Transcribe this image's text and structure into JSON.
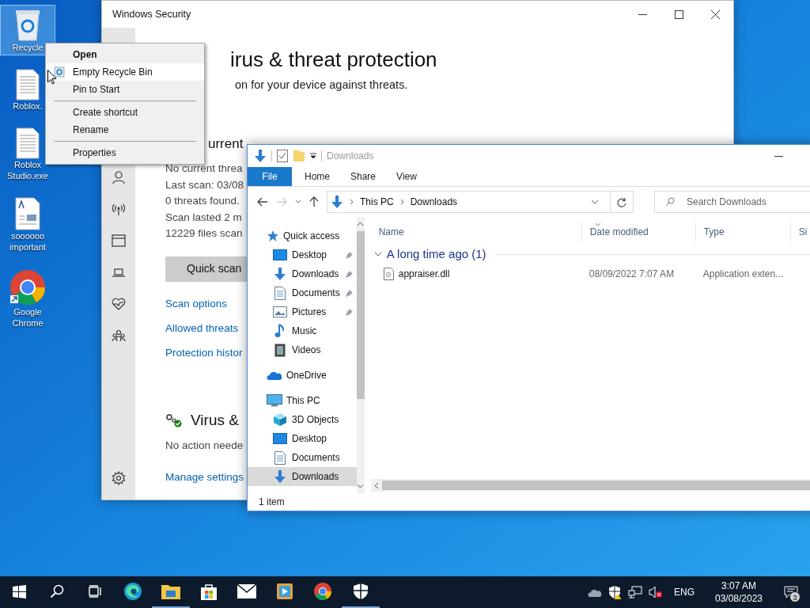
{
  "desktop": {
    "icons": [
      {
        "label": "Recycle",
        "kind": "recycle",
        "selected": true
      },
      {
        "label": "Roblox.",
        "kind": "file",
        "selected": false
      },
      {
        "label": "Roblox Studio.exe",
        "kind": "file",
        "selected": false
      },
      {
        "label": "soooooo important",
        "kind": "document",
        "selected": false
      },
      {
        "label": "Google Chrome",
        "kind": "chrome",
        "selected": false
      }
    ]
  },
  "context_menu": {
    "items": [
      {
        "kind": "item",
        "label": "Open",
        "default": true,
        "selected": false
      },
      {
        "kind": "icon_item",
        "label": "Empty Recycle Bin",
        "default": false,
        "selected": true
      },
      {
        "kind": "item",
        "label": "Pin to Start",
        "default": false,
        "selected": false
      },
      {
        "kind": "separator"
      },
      {
        "kind": "item",
        "label": "Create shortcut",
        "default": false,
        "selected": false
      },
      {
        "kind": "item",
        "label": "Rename",
        "default": false,
        "selected": false
      },
      {
        "kind": "separator"
      },
      {
        "kind": "item",
        "label": "Properties",
        "default": false,
        "selected": false
      }
    ]
  },
  "security": {
    "title": "Windows Security",
    "heading": "irus & threat protection",
    "subtitle": "on for your device against threats.",
    "current_heading": "urrent",
    "status_lines": [
      "No current threa",
      "Last scan: 03/08",
      "0 threats found.",
      "Scan lasted 2 m",
      "12229 files scan"
    ],
    "scan_button": "Quick scan",
    "links": [
      "Scan options",
      "Allowed threats",
      "Protection histor"
    ],
    "settings_heading": "Virus &",
    "settings_status": "No action neede",
    "settings_link": "Manage settings"
  },
  "explorer": {
    "title": "Downloads",
    "ribbon_tabs": [
      {
        "label": "File",
        "selected": true
      },
      {
        "label": "Home",
        "selected": false
      },
      {
        "label": "Share",
        "selected": false
      },
      {
        "label": "View",
        "selected": false
      }
    ],
    "breadcrumb": [
      "This PC",
      "Downloads"
    ],
    "search_placeholder": "Search Downloads",
    "nav": [
      {
        "label": "Quick access",
        "kind": "star",
        "selected": false,
        "children": [
          {
            "label": "Desktop",
            "kind": "desktop",
            "pinned": true,
            "selected": false
          },
          {
            "label": "Downloads",
            "kind": "download",
            "pinned": true,
            "selected": false
          },
          {
            "label": "Documents",
            "kind": "document",
            "pinned": true,
            "selected": false
          },
          {
            "label": "Pictures",
            "kind": "pictures",
            "pinned": true,
            "selected": false
          },
          {
            "label": "Music",
            "kind": "music",
            "pinned": false,
            "selected": false
          },
          {
            "label": "Videos",
            "kind": "videos",
            "pinned": false,
            "selected": false
          }
        ]
      },
      {
        "label": "OneDrive",
        "kind": "cloud",
        "selected": false
      },
      {
        "label": "This PC",
        "kind": "pc",
        "selected": false,
        "children": [
          {
            "label": "3D Objects",
            "kind": "cube",
            "pinned": false,
            "selected": false
          },
          {
            "label": "Desktop",
            "kind": "desktop",
            "pinned": false,
            "selected": false
          },
          {
            "label": "Documents",
            "kind": "document",
            "pinned": false,
            "selected": false
          },
          {
            "label": "Downloads",
            "kind": "download",
            "pinned": false,
            "selected": true
          }
        ]
      }
    ],
    "columns": [
      {
        "label": "Name",
        "sorted": false
      },
      {
        "label": "Date modified",
        "sorted": true
      },
      {
        "label": "Type",
        "sorted": false
      },
      {
        "label": "Si",
        "sorted": false
      }
    ],
    "groups": [
      {
        "label": "A long time ago (1)",
        "expanded": true,
        "files": [
          {
            "name": "appraiser.dll",
            "date": "08/09/2022 7:07 AM",
            "type": "Application exten..."
          }
        ]
      }
    ],
    "status": "1 item"
  },
  "taskbar": {
    "apps": [
      {
        "kind": "start",
        "running": false
      },
      {
        "kind": "search",
        "running": false
      },
      {
        "kind": "taskview",
        "running": false
      },
      {
        "kind": "edge",
        "running": false
      },
      {
        "kind": "explorer",
        "running": true
      },
      {
        "kind": "store",
        "running": false
      },
      {
        "kind": "mail",
        "running": false
      },
      {
        "kind": "media",
        "running": false
      },
      {
        "kind": "chrome",
        "running": false
      },
      {
        "kind": "shield",
        "running": true
      }
    ],
    "language": "ENG",
    "time": "3:07 AM",
    "date": "03/08/2023",
    "notifications": "3"
  }
}
